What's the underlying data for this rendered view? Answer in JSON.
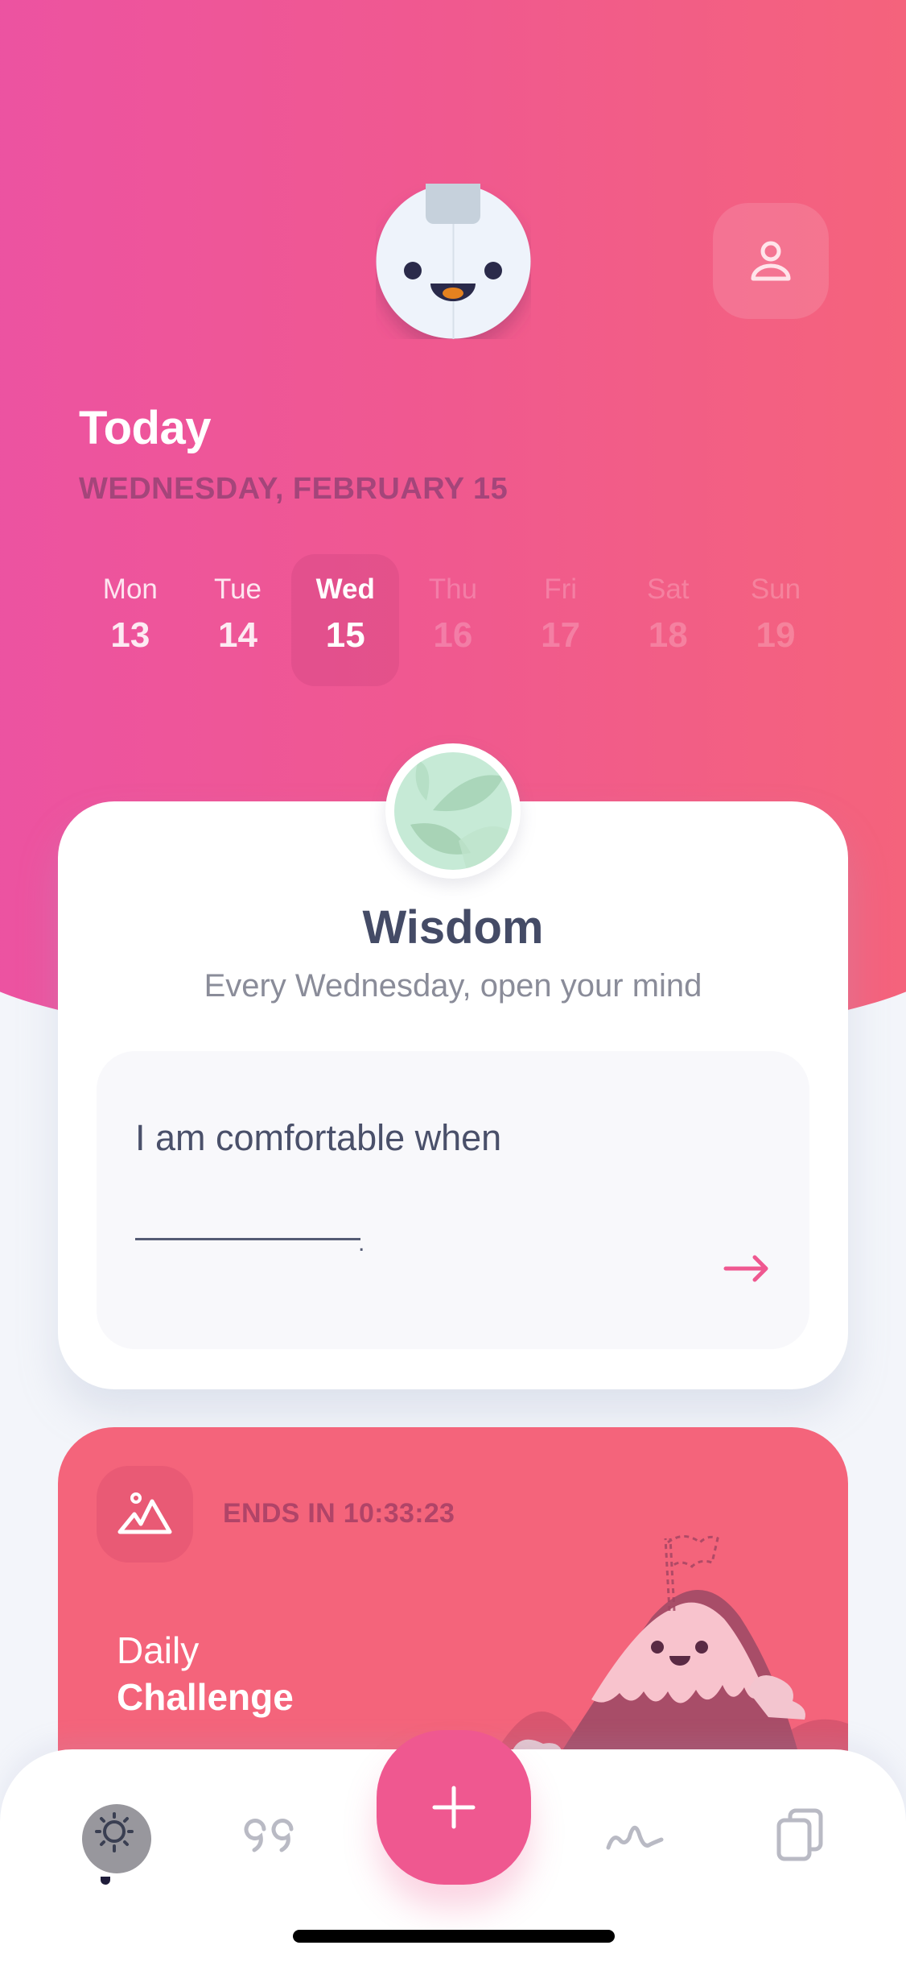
{
  "header": {
    "title": "Today",
    "date": "WEDNESDAY, FEBRUARY 15",
    "mascot_icon": "robot-face-mascot",
    "profile_icon": "user-icon"
  },
  "week": [
    {
      "name": "Mon",
      "num": "13",
      "state": "past"
    },
    {
      "name": "Tue",
      "num": "14",
      "state": "past"
    },
    {
      "name": "Wed",
      "num": "15",
      "state": "selected"
    },
    {
      "name": "Thu",
      "num": "16",
      "state": "future"
    },
    {
      "name": "Fri",
      "num": "17",
      "state": "future"
    },
    {
      "name": "Sat",
      "num": "18",
      "state": "future"
    },
    {
      "name": "Sun",
      "num": "19",
      "state": "future"
    }
  ],
  "wisdom": {
    "badge_icon": "leaves-icon",
    "title": "Wisdom",
    "subtitle": "Every Wednesday, open your mind",
    "prompt": "I am comfortable when",
    "prompt_end": ".",
    "submit_icon": "arrow-right-icon"
  },
  "challenge": {
    "icon": "mountain-icon",
    "timer": "ENDS IN 10:33:23",
    "line1": "Daily",
    "line2": "Challenge"
  },
  "tabbar": {
    "tabs": [
      {
        "name": "today",
        "icon": "sun-icon",
        "active": true
      },
      {
        "name": "quotes",
        "icon": "quote-icon",
        "active": false
      },
      {
        "name": "add",
        "icon": "plus-icon",
        "active": false
      },
      {
        "name": "insights",
        "icon": "wave-icon",
        "active": false
      },
      {
        "name": "entries",
        "icon": "cards-icon",
        "active": false
      }
    ]
  },
  "colors": {
    "gradient_start": "#EC52A3",
    "gradient_end": "#F5647A",
    "accent": "#EF5890",
    "challenge_bg": "#F4647B",
    "text_dark": "#444B66"
  }
}
